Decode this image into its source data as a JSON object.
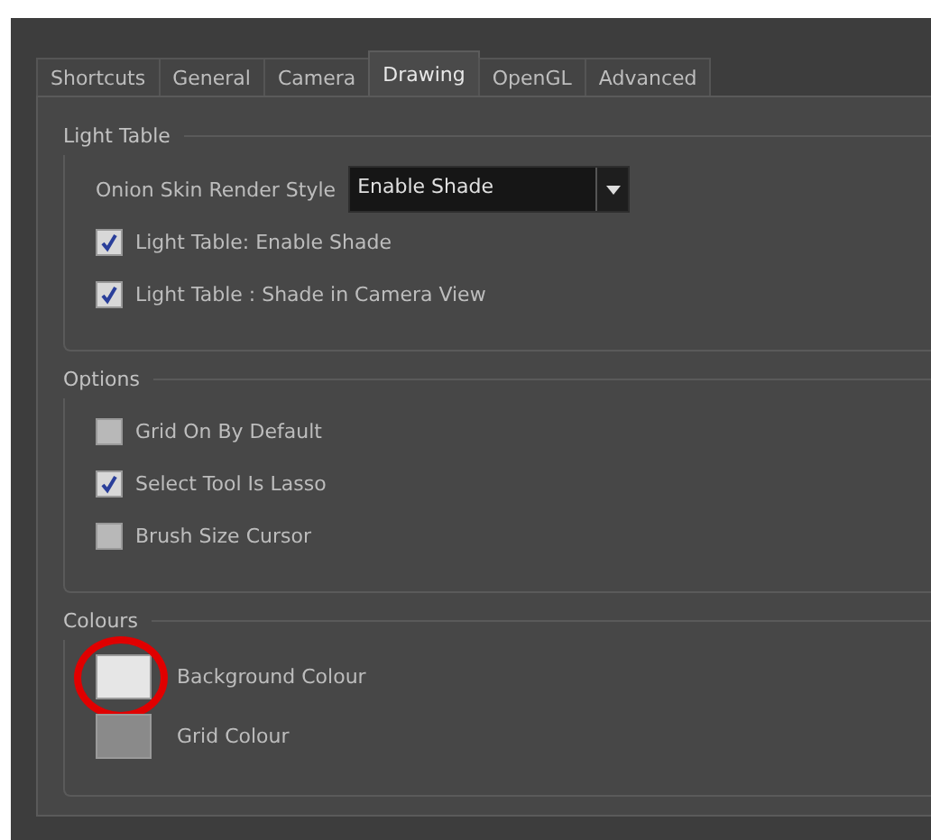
{
  "tabs": [
    {
      "label": "Shortcuts",
      "selected": false
    },
    {
      "label": "General",
      "selected": false
    },
    {
      "label": "Camera",
      "selected": false
    },
    {
      "label": "Drawing",
      "selected": true
    },
    {
      "label": "OpenGL",
      "selected": false
    },
    {
      "label": "Advanced",
      "selected": false
    }
  ],
  "groups": [
    {
      "title": "Light Table",
      "items": [
        {
          "kind": "dropdown",
          "label": "Onion Skin Render Style",
          "value": "Enable Shade"
        },
        {
          "kind": "checkbox",
          "label": "Light Table: Enable Shade",
          "checked": true
        },
        {
          "kind": "checkbox",
          "label": "Light Table : Shade in Camera View",
          "checked": true
        }
      ]
    },
    {
      "title": "Options",
      "items": [
        {
          "kind": "checkbox",
          "label": "Grid On By Default",
          "checked": false
        },
        {
          "kind": "checkbox",
          "label": "Select Tool Is Lasso",
          "checked": true
        },
        {
          "kind": "checkbox",
          "label": "Brush Size Cursor",
          "checked": false
        }
      ]
    },
    {
      "title": "Colours",
      "items": [
        {
          "kind": "swatch",
          "label": "Background Colour",
          "color": "#e6e6e6",
          "highlighted": true
        },
        {
          "kind": "swatch",
          "label": "Grid Colour",
          "color": "#8a8a8a",
          "highlighted": false
        }
      ]
    }
  ]
}
